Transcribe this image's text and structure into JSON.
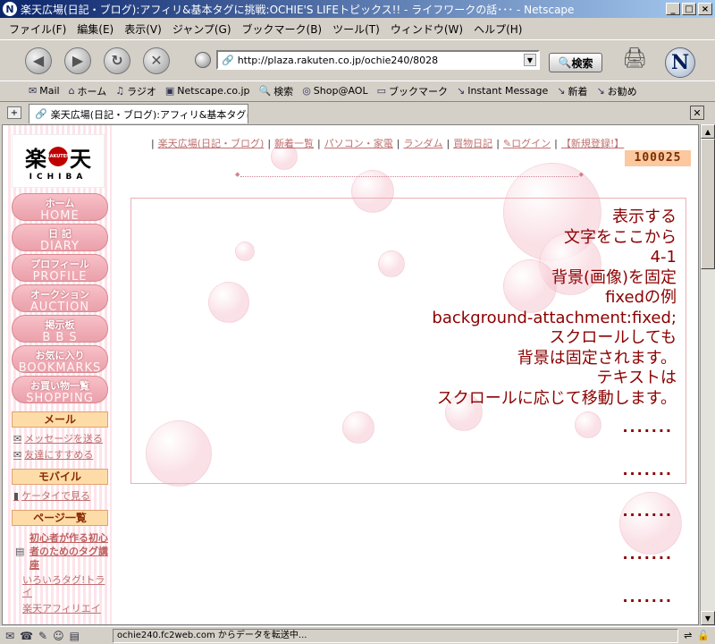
{
  "window": {
    "title": "楽天広場(日記・ブログ):アフィリ&基本タグに挑戦:OCHIE'S LIFEトピックス!! - ライフワークの話･･･ - Netscape",
    "controls": [
      "_",
      "□",
      "×"
    ]
  },
  "menu": [
    "ファイル(F)",
    "編集(E)",
    "表示(V)",
    "ジャンプ(G)",
    "ブックマーク(B)",
    "ツール(T)",
    "ウィンドウ(W)",
    "ヘルプ(H)"
  ],
  "nav": {
    "url": "http://plaza.rakuten.co.jp/ochie240/8028",
    "search_label": "検索",
    "logo_letter": "N"
  },
  "bookmarks": [
    {
      "icon": "mail-icon",
      "label": "Mail"
    },
    {
      "icon": "home-icon",
      "label": "ホーム"
    },
    {
      "icon": "radio-icon",
      "label": "ラジオ"
    },
    {
      "icon": "my-icon",
      "label": "Netscape.co.jp"
    },
    {
      "icon": "search-icon",
      "label": "検索"
    },
    {
      "icon": "shop-icon",
      "label": "Shop@AOL"
    },
    {
      "icon": "folder-icon",
      "label": "ブックマーク"
    },
    {
      "icon": "im-icon",
      "label": "Instant Message"
    },
    {
      "icon": "link-icon",
      "label": "新着"
    },
    {
      "icon": "link-icon",
      "label": "お勧め"
    }
  ],
  "tab": {
    "label": "楽天広場(日記・ブログ):アフィリ&基本タグに..."
  },
  "sidebar": {
    "logo_main_left": "楽",
    "logo_main_right": "天",
    "logo_dot_text": "RAKUTEN",
    "logo_sub": "ICHIBA",
    "nav": [
      {
        "jp": "ホーム",
        "en": "HOME"
      },
      {
        "jp": "日 記",
        "en": "DIARY"
      },
      {
        "jp": "プロフィール",
        "en": "PROFILE"
      },
      {
        "jp": "オークション",
        "en": "AUCTION"
      },
      {
        "jp": "掲示板",
        "en": "B B S"
      },
      {
        "jp": "お気に入り",
        "en": "BOOKMARKS"
      },
      {
        "jp": "お買い物一覧",
        "en": "SHOPPING LIST"
      }
    ],
    "mail_header": "メール",
    "mail_links": [
      "メッセージを送る",
      "友達にすすめる"
    ],
    "mobile_header": "モバイル",
    "mobile_link": "ケータイで見る",
    "pages_header": "ページ一覧",
    "page_link": "初心者が作る初心者のためのタグ講座",
    "sub_pages": [
      "いろいろタグ!トライ",
      "楽天アフィリエイ"
    ]
  },
  "toplinks": [
    "楽天広場(日記・ブログ)",
    "新着一覧",
    "パソコン・家電",
    "ランダム",
    "買物日記",
    "ログイン",
    "【新規登録!】"
  ],
  "counter": "100025",
  "main": {
    "lines": [
      "表示する",
      "文字をここから",
      "4-1",
      "背景(画像)を固定",
      "fixedの例",
      "background-attachment:fixed;",
      "スクロールしても",
      "背景は固定されます。",
      "テキストは",
      "スクロールに応じて移動します。"
    ],
    "dots": ".......",
    "dot_rows": 5
  },
  "status": {
    "text": "ochie240.fc2web.com からデータを転送中..."
  }
}
